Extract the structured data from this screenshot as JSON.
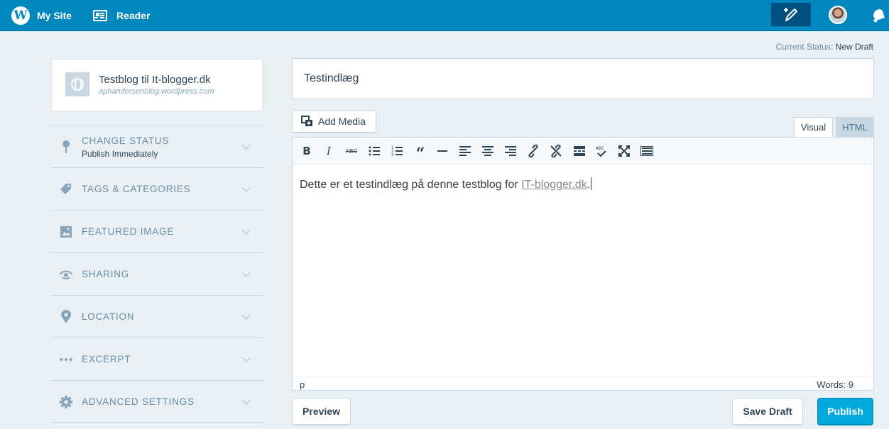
{
  "topbar": {
    "my_site_label": "My Site",
    "reader_label": "Reader",
    "icons": [
      "wordpress-logo",
      "reader-icon",
      "write-post-icon",
      "user-avatar",
      "notifications-icon"
    ]
  },
  "site": {
    "title": "Testblog til It-blogger.dk",
    "url": "aphandersenblog.wordpress.com"
  },
  "sidebar": {
    "sections": [
      {
        "label": "CHANGE STATUS",
        "sub": "Publish Immediately",
        "icon": "pin-icon"
      },
      {
        "label": "TAGS & CATEGORIES",
        "icon": "tag-icon"
      },
      {
        "label": "FEATURED IMAGE",
        "icon": "image-icon"
      },
      {
        "label": "SHARING",
        "icon": "share-icon"
      },
      {
        "label": "LOCATION",
        "icon": "location-icon"
      },
      {
        "label": "EXCERPT",
        "icon": "ellipsis-icon"
      },
      {
        "label": "ADVANCED SETTINGS",
        "icon": "gear-icon"
      }
    ]
  },
  "editor": {
    "status_label": "Current Status:",
    "status_value": "New Draft",
    "title": "Testindlæg",
    "add_media_label": "Add Media",
    "tab_visual": "Visual",
    "tab_html": "HTML",
    "content_text": "Dette er et testindlæg på denne testblog for ",
    "content_link": "IT-blogger.dk",
    "content_end": ".",
    "path": "p",
    "word_count": "Words: 9",
    "toolbar_icons": [
      "bold-icon",
      "italic-icon",
      "strikethrough-icon",
      "bullet-list-icon",
      "numbered-list-icon",
      "blockquote-icon",
      "horizontal-rule-icon",
      "align-left-icon",
      "align-center-icon",
      "align-right-icon",
      "link-icon",
      "unlink-icon",
      "more-tag-icon",
      "spellcheck-icon",
      "fullscreen-icon",
      "keyboard-icon"
    ]
  },
  "actions": {
    "preview": "Preview",
    "save_draft": "Save Draft",
    "publish": "Publish"
  },
  "colors": {
    "topbar": "#0087be",
    "publish": "#00aadc",
    "background": "#e9eff3"
  }
}
